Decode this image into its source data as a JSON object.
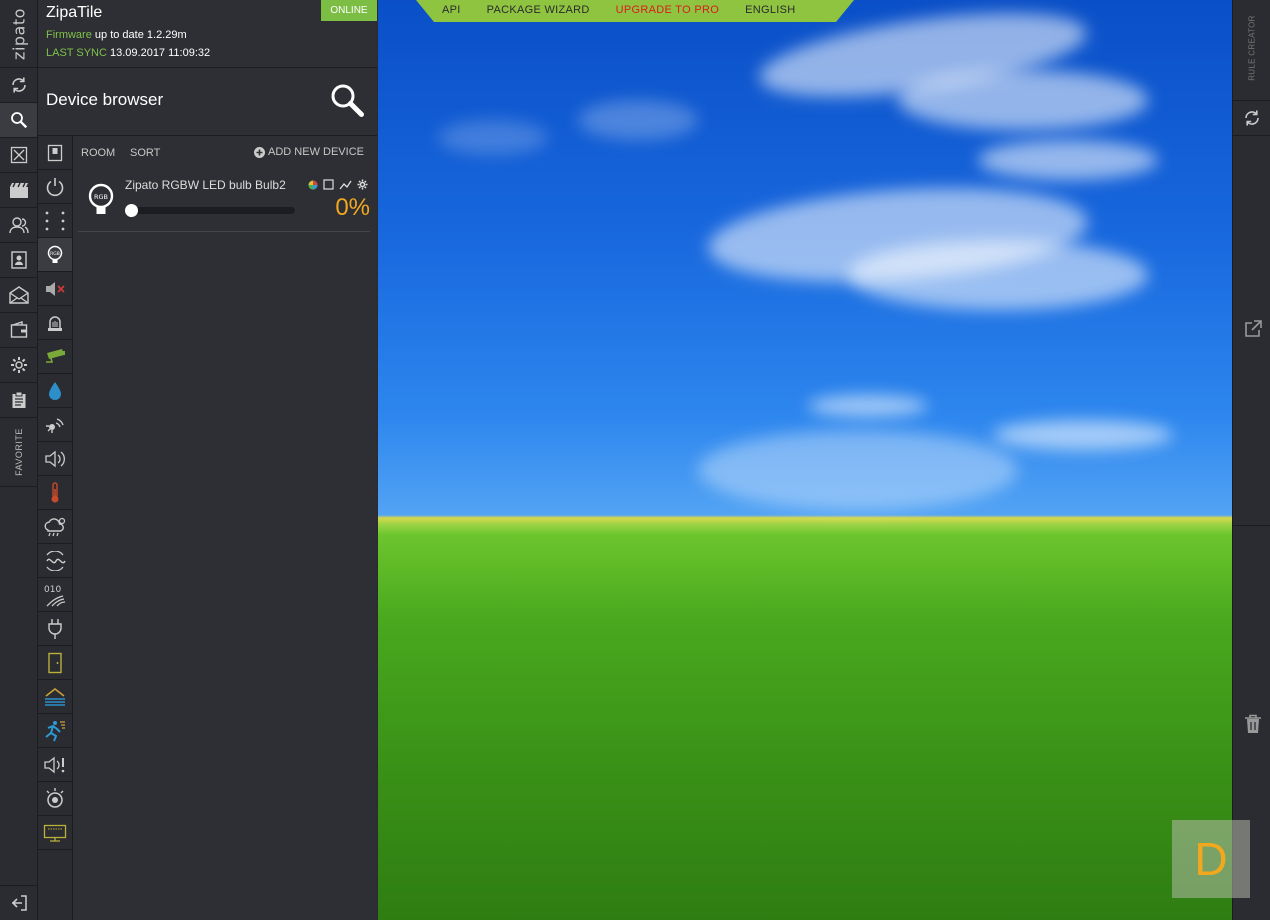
{
  "app": {
    "logo": "zipato",
    "title": "ZipaTile",
    "status": "ONLINE",
    "firmware_label": "Firmware",
    "firmware_value": "up to date 1.2.29m",
    "last_sync_label": "LAST SYNC",
    "last_sync_value": "13.09.2017 11:09:32"
  },
  "top_menu": {
    "items": [
      {
        "label": "API"
      },
      {
        "label": "PACKAGE WIZARD"
      },
      {
        "label": "UPGRADE TO PRO"
      },
      {
        "label": "ENGLISH"
      }
    ]
  },
  "rail": {
    "items": [
      {
        "icon": "refresh-icon"
      },
      {
        "icon": "search-icon",
        "active": true
      },
      {
        "icon": "expand-icon"
      },
      {
        "icon": "clapperboard-icon"
      },
      {
        "icon": "users-icon"
      },
      {
        "icon": "contact-card-icon"
      },
      {
        "icon": "envelope-icon"
      },
      {
        "icon": "wallet-icon"
      },
      {
        "icon": "gear-icon"
      },
      {
        "icon": "clipboard-icon"
      }
    ],
    "favorite_label": "FAVORITE",
    "exit_icon": "logout-icon"
  },
  "device_browser": {
    "title": "Device browser",
    "room_label": "ROOM",
    "sort_label": "SORT",
    "add_label": "ADD NEW DEVICE"
  },
  "categories": [
    "switch-icon",
    "power-icon",
    "dots-icon",
    "bulb-icon",
    "speaker-mute-icon",
    "siren-icon",
    "camera-icon",
    "water-drop-icon",
    "motion-sensor-icon",
    "speaker-icon",
    "thermometer-icon",
    "weather-icon",
    "vibration-icon",
    "binary-icon",
    "plug-icon",
    "door-icon",
    "flood-icon",
    "running-man-icon",
    "alarm-speaker-icon",
    "smoke-detector-icon",
    "display-icon"
  ],
  "devices": [
    {
      "name": "Zipato RGBW LED bulb Bulb2",
      "level_percent": 0,
      "level_text": "0%",
      "badge": "RGB"
    }
  ],
  "right_panel": {
    "rule_creator_label": "RULE CREATOR"
  },
  "badge": {
    "letter": "D"
  },
  "colors": {
    "online_green": "#7cbd44",
    "accent_orange": "#f0a820",
    "pro_red": "#d81d1d",
    "menu_bg": "#8fc440"
  }
}
